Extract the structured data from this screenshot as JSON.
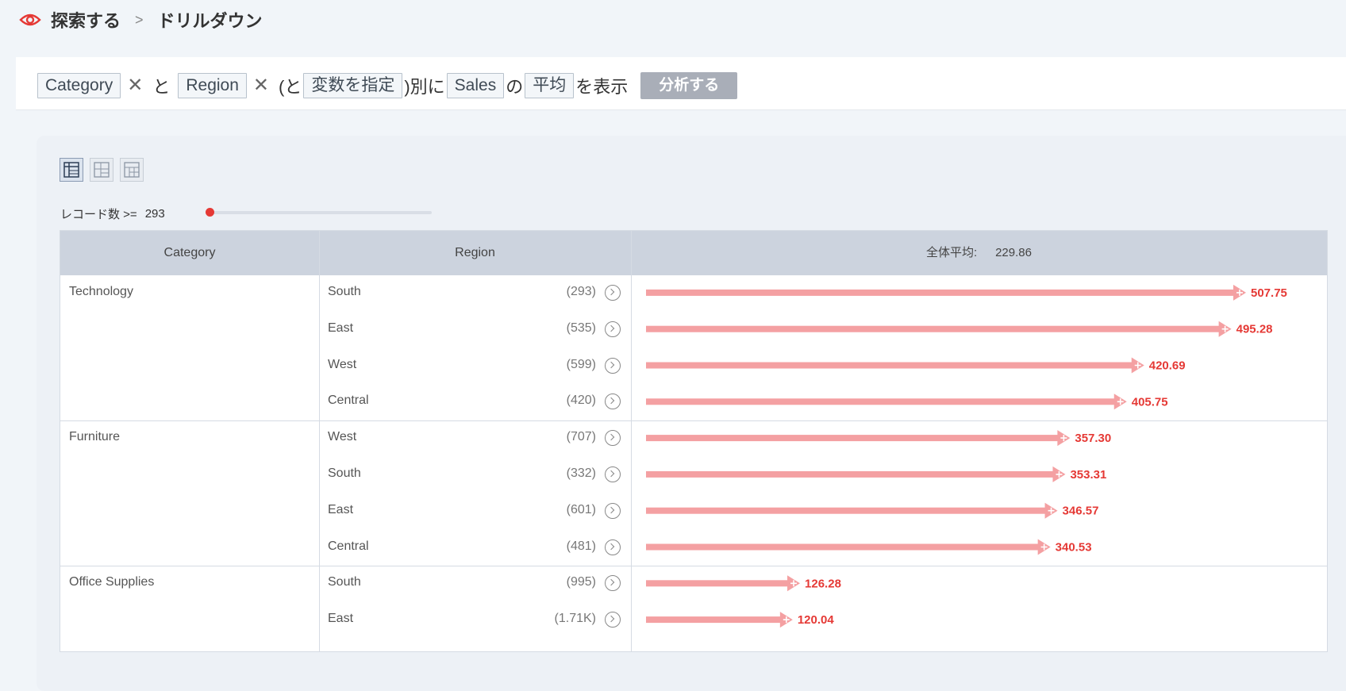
{
  "breadcrumb": {
    "parent": "探索する",
    "separator": ">",
    "current": "ドリルダウン"
  },
  "query": {
    "dim1": "Category",
    "conj1": "と",
    "dim2": "Region",
    "open_paren": "(と",
    "variable_placeholder": "変数を指定",
    "by": ")別に",
    "measure": "Sales",
    "particle": "の",
    "aggregation": "平均",
    "suffix": "を表示",
    "analyze_button": "分析する"
  },
  "filter": {
    "label": "レコード数 >=",
    "value": "293",
    "slider_fraction": 0.0
  },
  "table": {
    "headers": {
      "category": "Category",
      "region": "Region",
      "avg_label": "全体平均:",
      "avg_value": "229.86"
    },
    "max_value": 507.75,
    "accent_color": "#f4a0a2",
    "label_color": "#e53935",
    "groups": [
      {
        "category": "Technology",
        "rows": [
          {
            "region": "South",
            "count": "(293)",
            "value": 507.75,
            "label": "507.75"
          },
          {
            "region": "East",
            "count": "(535)",
            "value": 495.28,
            "label": "495.28"
          },
          {
            "region": "West",
            "count": "(599)",
            "value": 420.69,
            "label": "420.69"
          },
          {
            "region": "Central",
            "count": "(420)",
            "value": 405.75,
            "label": "405.75"
          }
        ]
      },
      {
        "category": "Furniture",
        "rows": [
          {
            "region": "West",
            "count": "(707)",
            "value": 357.3,
            "label": "357.30"
          },
          {
            "region": "South",
            "count": "(332)",
            "value": 353.31,
            "label": "353.31"
          },
          {
            "region": "East",
            "count": "(601)",
            "value": 346.57,
            "label": "346.57"
          },
          {
            "region": "Central",
            "count": "(481)",
            "value": 340.53,
            "label": "340.53"
          }
        ]
      },
      {
        "category": "Office Supplies",
        "rows": [
          {
            "region": "South",
            "count": "(995)",
            "value": 126.28,
            "label": "126.28"
          },
          {
            "region": "East",
            "count": "(1.71K)",
            "value": 120.04,
            "label": "120.04"
          }
        ]
      }
    ]
  }
}
